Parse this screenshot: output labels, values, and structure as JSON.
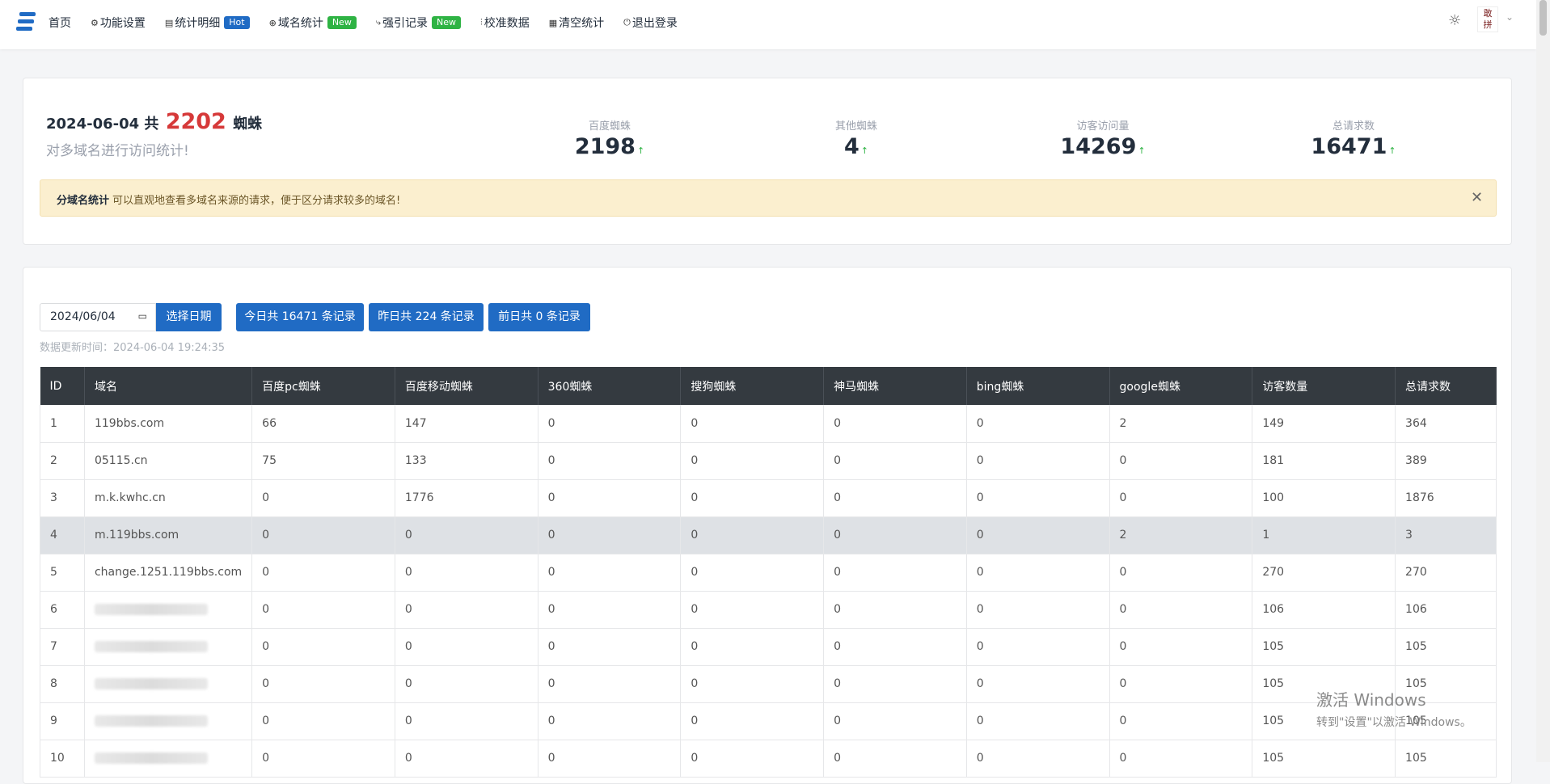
{
  "nav": {
    "items": [
      {
        "icon": "",
        "label": "首页"
      },
      {
        "icon": "⚙",
        "label": "功能设置"
      },
      {
        "icon": "▤",
        "label": "统计明细",
        "badge": "Hot"
      },
      {
        "icon": "⊕",
        "label": "域名统计",
        "badge": "New"
      },
      {
        "icon": "⤷",
        "label": "强引记录",
        "badge": "New"
      },
      {
        "icon": "⫶",
        "label": "校准数据"
      },
      {
        "icon": "▦",
        "label": "清空统计"
      },
      {
        "icon": "⏻",
        "label": "退出登录"
      }
    ]
  },
  "header": {
    "date": "2024-06-04 共",
    "count": "2202",
    "unit": "蜘蛛",
    "subtitle": "对多域名进行访问统计!"
  },
  "stats": [
    {
      "label": "百度蜘蛛",
      "value": "2198"
    },
    {
      "label": "其他蜘蛛",
      "value": "4"
    },
    {
      "label": "访客访问量",
      "value": "14269"
    },
    {
      "label": "总请求数",
      "value": "16471"
    }
  ],
  "alert": {
    "title": "分域名统计",
    "text": "可以直观地查看多域名来源的请求，便于区分请求较多的域名!"
  },
  "filters": {
    "date_value": "2024/06/04",
    "select_btn": "选择日期",
    "today_btn": "今日共 16471 条记录",
    "yesterday_btn": "昨日共 224 条记录",
    "before_btn": "前日共 0 条记录",
    "update_time": "数据更新时间：2024-06-04 19:24:35"
  },
  "table": {
    "headers": [
      "ID",
      "域名",
      "百度pc蜘蛛",
      "百度移动蜘蛛",
      "360蜘蛛",
      "搜狗蜘蛛",
      "神马蜘蛛",
      "bing蜘蛛",
      "google蜘蛛",
      "访客数量",
      "总请求数"
    ],
    "rows": [
      [
        "1",
        "119bbs.com",
        "66",
        "147",
        "0",
        "0",
        "0",
        "0",
        "2",
        "149",
        "364"
      ],
      [
        "2",
        "05115.cn",
        "75",
        "133",
        "0",
        "0",
        "0",
        "0",
        "0",
        "181",
        "389"
      ],
      [
        "3",
        "m.k.kwhc.cn",
        "0",
        "1776",
        "0",
        "0",
        "0",
        "0",
        "0",
        "100",
        "1876"
      ],
      [
        "4",
        "m.119bbs.com",
        "0",
        "0",
        "0",
        "0",
        "0",
        "0",
        "2",
        "1",
        "3"
      ],
      [
        "5",
        "change.1251.119bbs.com",
        "0",
        "0",
        "0",
        "0",
        "0",
        "0",
        "0",
        "270",
        "270"
      ],
      [
        "6",
        "",
        "0",
        "0",
        "0",
        "0",
        "0",
        "0",
        "0",
        "106",
        "106"
      ],
      [
        "7",
        "",
        "0",
        "0",
        "0",
        "0",
        "0",
        "0",
        "0",
        "105",
        "105"
      ],
      [
        "8",
        "",
        "0",
        "0",
        "0",
        "0",
        "0",
        "0",
        "0",
        "105",
        "105"
      ],
      [
        "9",
        "",
        "0",
        "0",
        "0",
        "0",
        "0",
        "0",
        "0",
        "105",
        "105"
      ],
      [
        "10",
        "",
        "0",
        "0",
        "0",
        "0",
        "0",
        "0",
        "0",
        "105",
        "105"
      ]
    ]
  },
  "watermark": {
    "line1": "激活 Windows",
    "line2": "转到\"设置\"以激活 Windows。"
  },
  "colors": {
    "primary": "#206bc4",
    "danger": "#d63939",
    "success": "#2fb344",
    "header_dark": "#343a40",
    "alert_bg": "#fbefcf"
  }
}
